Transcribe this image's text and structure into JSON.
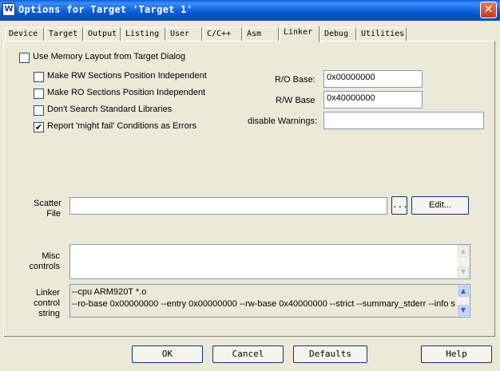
{
  "window": {
    "title": "Options for Target 'Target 1'",
    "close_glyph": "✕",
    "icon_glyph": "W"
  },
  "tabs": [
    "Device",
    "Target",
    "Output",
    "Listing",
    "User",
    "C/C++",
    "Asm",
    "Linker",
    "Debug",
    "Utilities"
  ],
  "active_tab": "Linker",
  "use_memory_layout": {
    "label": "Use Memory Layout from Target Dialog",
    "checked": false
  },
  "options": [
    {
      "label": "Make RW Sections Position Independent",
      "checked": false
    },
    {
      "label": "Make RO Sections Position Independent",
      "checked": false
    },
    {
      "label": "Don't Search Standard Libraries",
      "checked": false
    },
    {
      "label": "Report 'might fail' Conditions as Errors",
      "checked": true
    }
  ],
  "check_glyph": "✔",
  "ro_base": {
    "label": "R/O Base:",
    "value": "0x00000000"
  },
  "rw_base": {
    "label": "R/W Base",
    "value": "0x40000000"
  },
  "disable_warnings": {
    "label": "disable Warnings:",
    "value": ""
  },
  "scatter": {
    "label_line1": "Scatter",
    "label_line2": "File",
    "value": "",
    "browse_label": "...",
    "edit_label": "Edit..."
  },
  "misc": {
    "label_line1": "Misc",
    "label_line2": "controls",
    "value": ""
  },
  "linker_control": {
    "label_line1": "Linker",
    "label_line2": "control",
    "label_line3": "string",
    "lines": [
      "--cpu ARM920T *.o",
      "--ro-base 0x00000000 --entry 0x00000000 --rw-base 0x40000000 --strict --summary_stderr --info summa"
    ]
  },
  "scroll_up_glyph": "▲",
  "scroll_down_glyph": "▼",
  "buttons": {
    "ok": "OK",
    "cancel": "Cancel",
    "defaults": "Defaults",
    "help": "Help"
  }
}
